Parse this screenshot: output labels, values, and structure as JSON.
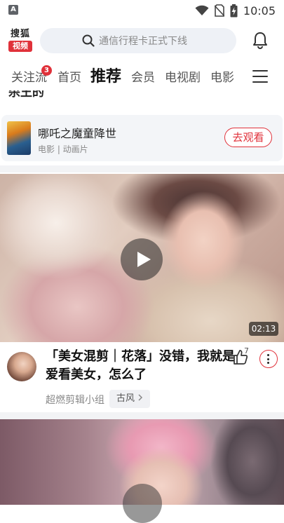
{
  "status_bar": {
    "app_icon_letter": "A",
    "time": "10:05",
    "icons": [
      "wifi-icon",
      "no-sim-icon",
      "battery-charging-icon"
    ]
  },
  "header": {
    "logo_top": "搜狐",
    "logo_bottom": "视频",
    "search_placeholder": "通信行程卡正式下线",
    "icons": [
      "search-icon",
      "bell-icon"
    ]
  },
  "tabs": {
    "items": [
      {
        "label": "关注流",
        "badge": "3"
      },
      {
        "label": "首页"
      },
      {
        "label": "推荐",
        "active": true
      },
      {
        "label": "会员"
      },
      {
        "label": "电视剧"
      },
      {
        "label": "电影"
      }
    ],
    "menu_icon": "hamburger-icon"
  },
  "cut_off_text": "杀王的",
  "movie_card": {
    "title": "哪吒之魔童降世",
    "meta": "电影 | 动画片",
    "button_label": "去观看"
  },
  "video": {
    "duration": "02:13",
    "title": "「美女混剪｜花落」没错，我就是爱看美女，怎么了",
    "author": "超燃剪辑小组",
    "tag": "古风",
    "like_count": "7",
    "icons": [
      "play-icon",
      "thumbs-up-icon",
      "more-vertical-icon",
      "chevron-right-icon"
    ]
  },
  "colors": {
    "accent_red": "#e0313a",
    "search_bg": "#eef1f6",
    "card_bg": "#f3f5f8"
  }
}
